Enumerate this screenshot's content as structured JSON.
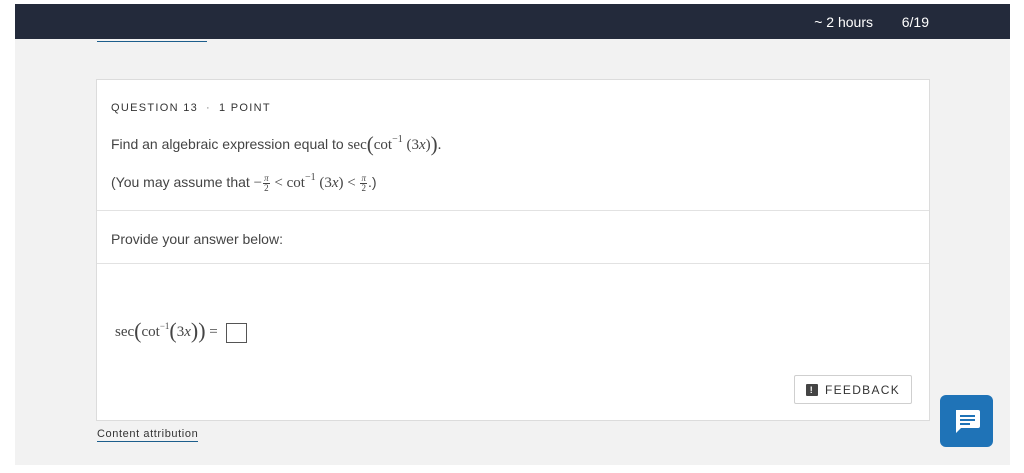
{
  "topbar": {
    "time_remaining": "~ 2 hours",
    "progress": "6/19"
  },
  "question": {
    "number_label": "QUESTION 13",
    "separator": "·",
    "points_label": "1 POINT",
    "prompt_text": "Find an algebraic expression equal to",
    "assume_prefix": "(You may assume that",
    "assume_suffix": ".)"
  },
  "answer": {
    "label": "Provide your answer below:",
    "input_value": ""
  },
  "feedback": {
    "label": "FEEDBACK"
  },
  "footer": {
    "attribution_link": "Content attribution"
  },
  "icons": {
    "feedback": "exclamation-speech-icon",
    "chat": "chat-bubble-icon"
  },
  "colors": {
    "topbar": "#232a3b",
    "accent": "#1f73b7"
  }
}
